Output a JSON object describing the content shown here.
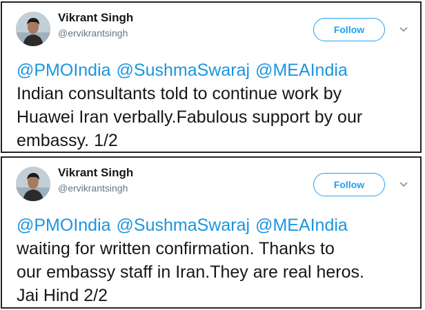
{
  "tweets": [
    {
      "author": {
        "name": "Vikrant Singh",
        "handle": "@ervikrantsingh"
      },
      "follow_label": "Follow",
      "mentions": [
        "@PMOIndia",
        "@SushmaSwaraj",
        "@MEAIndia"
      ],
      "lines": [
        "Indian consultants told to continue work by",
        "Huawei Iran verbally.Fabulous support by our",
        "embassy. 1/2"
      ]
    },
    {
      "author": {
        "name": "Vikrant Singh",
        "handle": "@ervikrantsingh"
      },
      "follow_label": "Follow",
      "mentions": [
        "@PMOIndia",
        "@SushmaSwaraj",
        "@MEAIndia"
      ],
      "lines": [
        "waiting for written confirmation. Thanks to",
        "our embassy staff in Iran.They are real heros.",
        "Jai Hind 2/2"
      ]
    }
  ],
  "icons": {
    "menu": "chevron-down-icon",
    "avatar": "profile-photo"
  },
  "colors": {
    "accent": "#1da1f2",
    "mention": "#1b95e0",
    "text": "#14171a",
    "muted": "#657786"
  }
}
